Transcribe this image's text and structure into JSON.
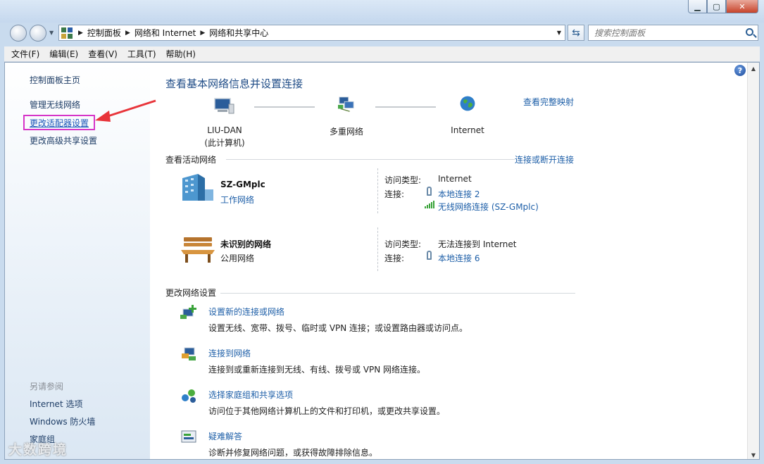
{
  "address": {
    "crumbs": [
      "控制面板",
      "网络和 Internet",
      "网络和共享中心"
    ],
    "search_placeholder": "搜索控制面板"
  },
  "menu": [
    "文件(F)",
    "编辑(E)",
    "查看(V)",
    "工具(T)",
    "帮助(H)"
  ],
  "sidebar": {
    "home": "控制面板主页",
    "links": [
      "管理无线网络",
      "更改适配器设置",
      "更改高级共享设置"
    ],
    "see_also_label": "另请参阅",
    "see_also": [
      "Internet 选项",
      "Windows 防火墙",
      "家庭组"
    ]
  },
  "main": {
    "title": "查看基本网络信息并设置连接",
    "map_link": "查看完整映射",
    "nodes": [
      {
        "line1": "LIU-DAN",
        "line2": "(此计算机)"
      },
      {
        "line1": "多重网络",
        "line2": ""
      },
      {
        "line1": "Internet",
        "line2": ""
      }
    ],
    "active_label": "查看活动网络",
    "connect_link": "连接或断开连接",
    "networks": [
      {
        "name": "SZ-GMplc",
        "type": "工作网络",
        "access_label": "访问类型:",
        "access_value": "Internet",
        "conn_label": "连接:",
        "connections": [
          "本地连接 2",
          "无线网络连接 (SZ-GMplc)"
        ]
      },
      {
        "name": "未识别的网络",
        "type": "公用网络",
        "access_label": "访问类型:",
        "access_value": "无法连接到 Internet",
        "conn_label": "连接:",
        "connections": [
          "本地连接 6"
        ]
      }
    ],
    "change_label": "更改网络设置",
    "tasks": [
      {
        "title": "设置新的连接或网络",
        "desc": "设置无线、宽带、拨号、临时或 VPN 连接；或设置路由器或访问点。"
      },
      {
        "title": "连接到网络",
        "desc": "连接到或重新连接到无线、有线、拨号或 VPN 网络连接。"
      },
      {
        "title": "选择家庭组和共享选项",
        "desc": "访问位于其他网络计算机上的文件和打印机，或更改共享设置。"
      },
      {
        "title": "疑难解答",
        "desc": "诊断并修复网络问题，或获得故障排除信息。"
      }
    ]
  },
  "watermark": "大数跨境",
  "colors": {
    "link": "#1e5fa8",
    "highlight_box": "#d635c8",
    "arrow": "#e8343a"
  }
}
